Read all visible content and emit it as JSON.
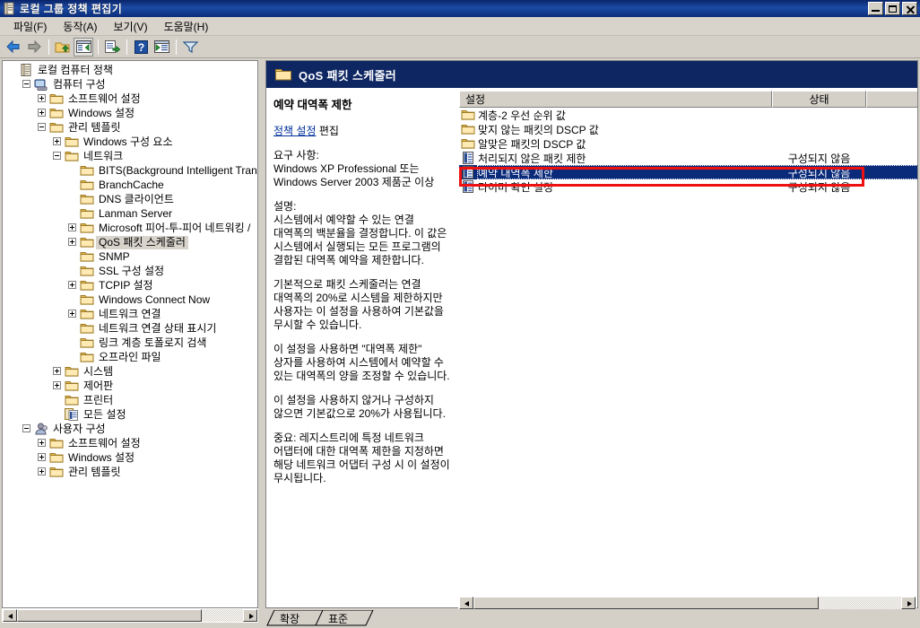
{
  "window": {
    "title": "로컬 그룹 정책 편집기",
    "icon": "scroll-document-icon",
    "buttons": {
      "minimize": "_",
      "restore": "❐",
      "close": "✕"
    }
  },
  "menu": {
    "items": [
      {
        "label": "파일(F)",
        "name": "menu-file"
      },
      {
        "label": "동작(A)",
        "name": "menu-action"
      },
      {
        "label": "보기(V)",
        "name": "menu-view"
      },
      {
        "label": "도움말(H)",
        "name": "menu-help"
      }
    ]
  },
  "toolbar": {
    "items": [
      {
        "name": "back-icon",
        "title": "뒤로"
      },
      {
        "name": "forward-icon",
        "title": "앞으로"
      },
      {
        "name": "up-folder-icon",
        "title": "위로"
      },
      {
        "name": "show-tree-icon",
        "title": "트리 표시"
      },
      {
        "name": "export-list-icon",
        "title": "목록 내보내기"
      },
      {
        "name": "help-icon",
        "title": "도움말"
      },
      {
        "name": "properties-icon",
        "title": "속성"
      },
      {
        "name": "filter-icon",
        "title": "필터"
      }
    ]
  },
  "tree": {
    "nodes": [
      {
        "label": "로컬 컴퓨터 정책",
        "indent": 0,
        "icon": "scroll-icon",
        "expander": "none",
        "selected": false
      },
      {
        "label": "컴퓨터 구성",
        "indent": 1,
        "icon": "computer-icon",
        "expander": "minus",
        "selected": false
      },
      {
        "label": "소프트웨어 설정",
        "indent": 2,
        "icon": "folder-icon",
        "expander": "plus",
        "selected": false
      },
      {
        "label": "Windows 설정",
        "indent": 2,
        "icon": "folder-icon",
        "expander": "plus",
        "selected": false
      },
      {
        "label": "관리 템플릿",
        "indent": 2,
        "icon": "folder-icon",
        "expander": "minus",
        "selected": false
      },
      {
        "label": "Windows 구성 요소",
        "indent": 3,
        "icon": "folder-icon",
        "expander": "plus",
        "selected": false
      },
      {
        "label": "네트워크",
        "indent": 3,
        "icon": "folder-icon",
        "expander": "minus",
        "selected": false
      },
      {
        "label": "BITS(Background Intelligent Trans",
        "indent": 4,
        "icon": "folder-icon",
        "expander": "none",
        "selected": false
      },
      {
        "label": "BranchCache",
        "indent": 4,
        "icon": "folder-icon",
        "expander": "none",
        "selected": false
      },
      {
        "label": "DNS 클라이언트",
        "indent": 4,
        "icon": "folder-icon",
        "expander": "none",
        "selected": false
      },
      {
        "label": "Lanman Server",
        "indent": 4,
        "icon": "folder-icon",
        "expander": "none",
        "selected": false
      },
      {
        "label": "Microsoft 피어-투-피어 네트워킹 /",
        "indent": 4,
        "icon": "folder-icon",
        "expander": "plus",
        "selected": false
      },
      {
        "label": "QoS 패킷 스케줄러",
        "indent": 4,
        "icon": "folder-icon",
        "expander": "plus",
        "selected": true
      },
      {
        "label": "SNMP",
        "indent": 4,
        "icon": "folder-icon",
        "expander": "none",
        "selected": false
      },
      {
        "label": "SSL 구성 설정",
        "indent": 4,
        "icon": "folder-icon",
        "expander": "none",
        "selected": false
      },
      {
        "label": "TCPIP 설정",
        "indent": 4,
        "icon": "folder-icon",
        "expander": "plus",
        "selected": false
      },
      {
        "label": "Windows Connect Now",
        "indent": 4,
        "icon": "folder-icon",
        "expander": "none",
        "selected": false
      },
      {
        "label": "네트워크 연결",
        "indent": 4,
        "icon": "folder-icon",
        "expander": "plus",
        "selected": false
      },
      {
        "label": "네트워크 연결 상태 표시기",
        "indent": 4,
        "icon": "folder-icon",
        "expander": "none",
        "selected": false
      },
      {
        "label": "링크 계층 토폴로지 검색",
        "indent": 4,
        "icon": "folder-icon",
        "expander": "none",
        "selected": false
      },
      {
        "label": "오프라인 파일",
        "indent": 4,
        "icon": "folder-icon",
        "expander": "none",
        "selected": false
      },
      {
        "label": "시스템",
        "indent": 3,
        "icon": "folder-icon",
        "expander": "plus",
        "selected": false
      },
      {
        "label": "제어판",
        "indent": 3,
        "icon": "folder-icon",
        "expander": "plus",
        "selected": false
      },
      {
        "label": "프린터",
        "indent": 3,
        "icon": "folder-icon",
        "expander": "none",
        "selected": false
      },
      {
        "label": "모든 설정",
        "indent": 3,
        "icon": "all-settings-icon",
        "expander": "none",
        "selected": false
      },
      {
        "label": "사용자 구성",
        "indent": 1,
        "icon": "user-icon",
        "expander": "minus",
        "selected": false
      },
      {
        "label": "소프트웨어 설정",
        "indent": 2,
        "icon": "folder-icon",
        "expander": "plus",
        "selected": false
      },
      {
        "label": "Windows 설정",
        "indent": 2,
        "icon": "folder-icon",
        "expander": "plus",
        "selected": false
      },
      {
        "label": "관리 템플릿",
        "indent": 2,
        "icon": "folder-icon",
        "expander": "plus",
        "selected": false
      }
    ]
  },
  "content_header": {
    "title": "QoS 패킷 스케줄러",
    "icon": "folder-icon"
  },
  "description": {
    "title": "예약 대역폭 제한",
    "edit_link": "정책 설정",
    "edit_suffix": " 편집",
    "requirement_label": "요구 사항:",
    "requirement_text": "Windows XP Professional 또는 Windows Server 2003 제품군 이상",
    "explain_label": "설명:",
    "paragraphs": [
      "시스템에서 예약할 수 있는 연결 대역폭의 백분율을 결정합니다. 이 값은 시스템에서 실행되는 모든 프로그램의 결합된 대역폭 예약을 제한합니다.",
      "기본적으로 패킷 스케줄러는 연결 대역폭의 20%로 시스템을 제한하지만 사용자는 이 설정을 사용하여 기본값을 무시할 수 있습니다.",
      "이 설정을 사용하면 \"대역폭 제한\" 상자를 사용하여 시스템에서 예약할 수 있는 대역폭의 양을 조정할 수 있습니다.",
      "이 설정을 사용하지 않거나 구성하지 않으면 기본값으로 20%가 사용됩니다.",
      "중요: 레지스트리에 특정 네트워크 어댑터에 대한 대역폭 제한을 지정하면 해당 네트워크 어댑터 구성 시 이 설정이 무시됩니다."
    ]
  },
  "list": {
    "columns": [
      {
        "label": "설정",
        "name": "column-setting"
      },
      {
        "label": "상태",
        "name": "column-state"
      },
      {
        "label": "",
        "name": "column-extra"
      }
    ],
    "rows": [
      {
        "name": "계층-2 우선 순위 값",
        "state": "",
        "icon": "folder-icon",
        "selected": false
      },
      {
        "name": "맞지 않는 패킷의 DSCP 값",
        "state": "",
        "icon": "folder-icon",
        "selected": false
      },
      {
        "name": "알맞은 패킷의 DSCP 값",
        "state": "",
        "icon": "folder-icon",
        "selected": false
      },
      {
        "name": "처리되지 않은 패킷 제한",
        "state": "구성되지 않음",
        "icon": "policy-icon",
        "selected": false
      },
      {
        "name": "예약 대역폭 제한",
        "state": "구성되지 않음",
        "icon": "policy-icon",
        "selected": true
      },
      {
        "name": "타이머 확인 설정",
        "state": "구성되지 않음",
        "icon": "policy-icon",
        "selected": false
      }
    ]
  },
  "tabs": {
    "items": [
      {
        "label": "확장",
        "name": "tab-extended",
        "active": false
      },
      {
        "label": "표준",
        "name": "tab-standard",
        "active": true
      }
    ]
  },
  "scrollbars": {
    "left_pane": {
      "name": "left-hscrollbar"
    },
    "right_pane": {
      "name": "right-hscrollbar"
    }
  },
  "colors": {
    "titlebar": "#0a246a",
    "header_blue": "#0e2763",
    "selection": "#0a2a7a",
    "annotation_red": "#ee1111",
    "face": "#d4d0c8"
  }
}
